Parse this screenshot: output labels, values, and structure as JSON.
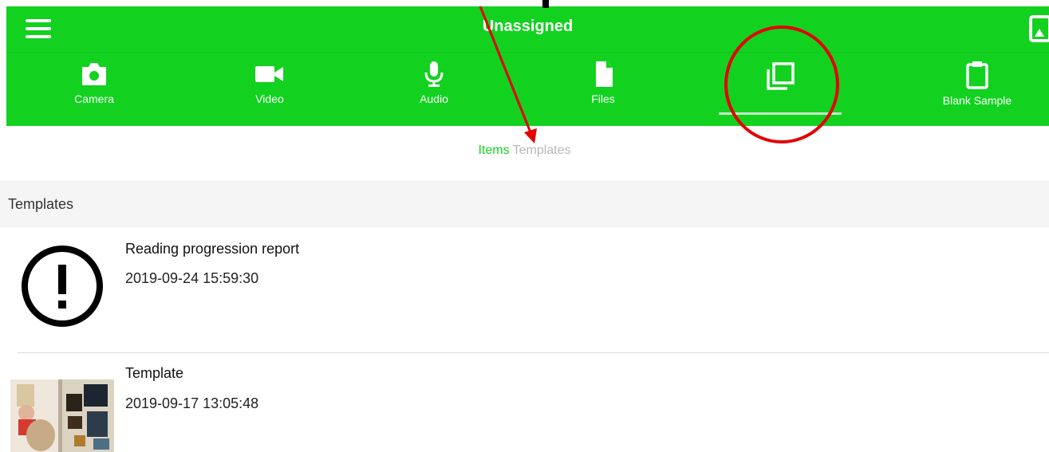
{
  "header": {
    "title": "Unassigned",
    "background_color": "#12d21f"
  },
  "toolbar": {
    "items": [
      {
        "label": "Camera",
        "icon": "camera-icon"
      },
      {
        "label": "Video",
        "icon": "video-camera-icon"
      },
      {
        "label": "Audio",
        "icon": "microphone-icon"
      },
      {
        "label": "Files",
        "icon": "file-icon"
      },
      {
        "label": "",
        "icon": "templates-stack-icon",
        "selected": true
      },
      {
        "label": "Blank Sample",
        "icon": "clipboard-icon"
      }
    ]
  },
  "tabs": {
    "items_label": "Items",
    "templates_label": "Templates",
    "active_color": "#12d21f",
    "inactive_color": "#b8b8b8"
  },
  "section": {
    "header": "Templates"
  },
  "templates": [
    {
      "title": "Reading progression report",
      "date": "2019-09-24 15:59:30",
      "thumbnail": "warning-icon"
    },
    {
      "title": "Template",
      "date": "2019-09-17 13:05:48",
      "thumbnail": "photo-thumbnail"
    }
  ],
  "annotation": {
    "color": "#e30000"
  }
}
